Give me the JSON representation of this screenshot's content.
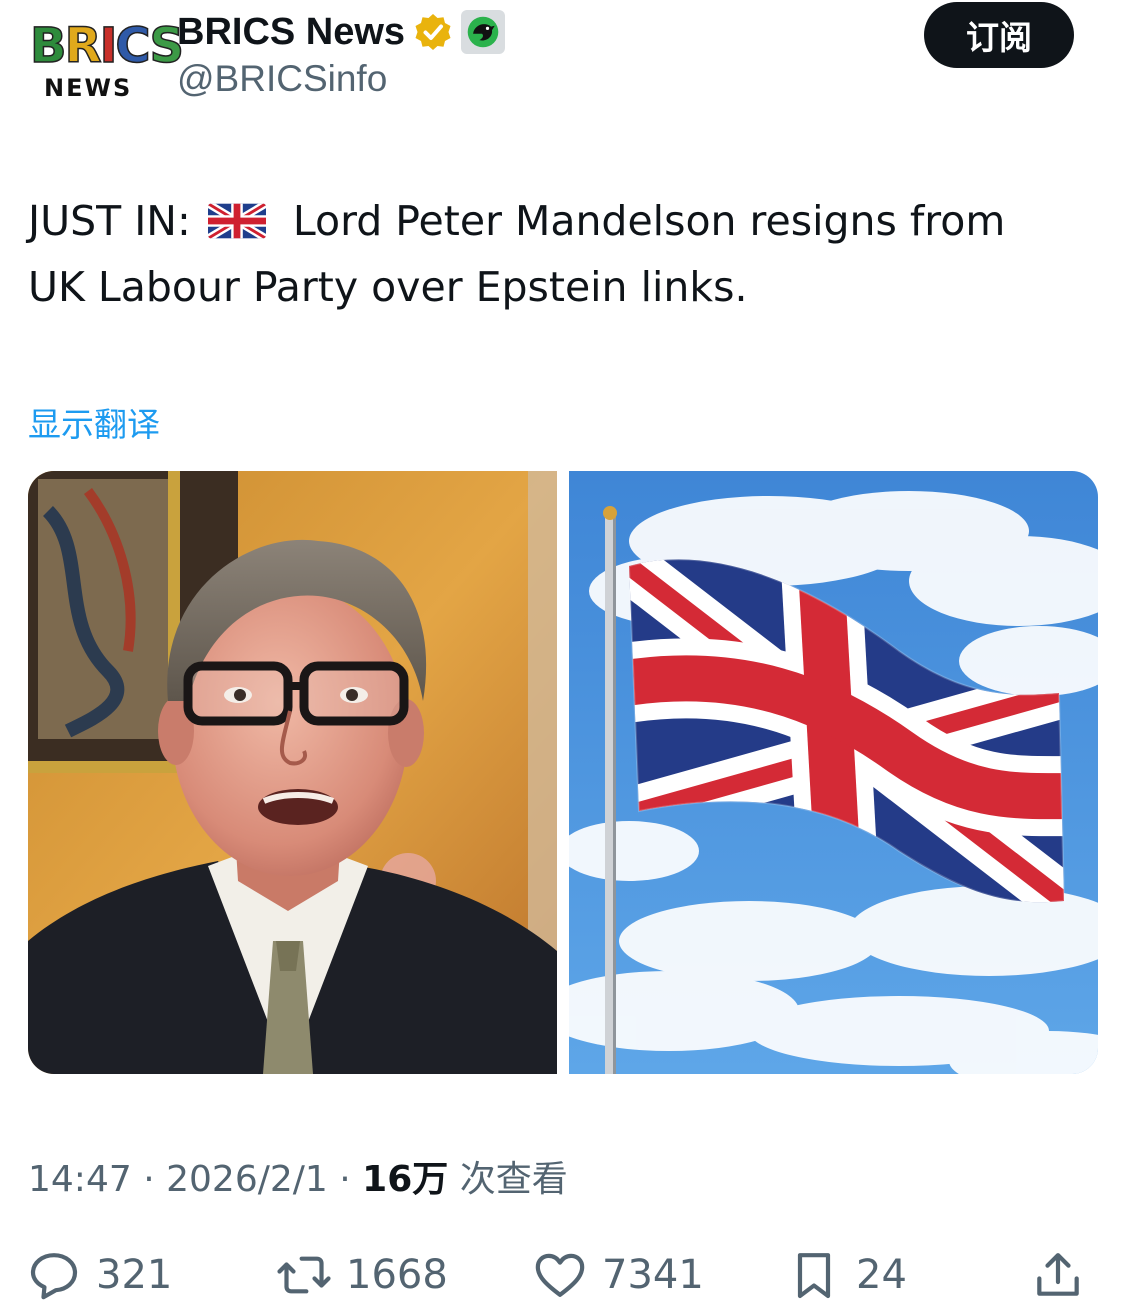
{
  "header": {
    "avatar": {
      "brand": "BRICS",
      "sub": "NEWS"
    },
    "display_name": "BRICS News",
    "handle": "@BRICSinfo",
    "badges": [
      "verified-gold-icon",
      "affiliation-icon"
    ],
    "subscribe_label": "订阅"
  },
  "tweet": {
    "prefix": "JUST IN:",
    "flag": "uk-flag-emoji",
    "body_line1": "Lord Peter Mandelson resigns from",
    "body_line2": "UK Labour Party over Epstein links.",
    "translate_label": "显示翻译"
  },
  "media": [
    {
      "name": "portrait-photo",
      "kind": "image"
    },
    {
      "name": "union-jack-flag-photo",
      "kind": "image"
    }
  ],
  "meta": {
    "time": "14:47",
    "sep1": "·",
    "date": "2026/2/1",
    "sep2": "·",
    "views": "16万",
    "views_label": "次查看"
  },
  "actions": {
    "replies": "321",
    "retweets": "1668",
    "likes": "7341",
    "bookmarks": "24"
  },
  "colors": {
    "accent": "#1d9bf0",
    "text": "#0f1419",
    "muted": "#536471",
    "verified": "#e9b30d"
  }
}
